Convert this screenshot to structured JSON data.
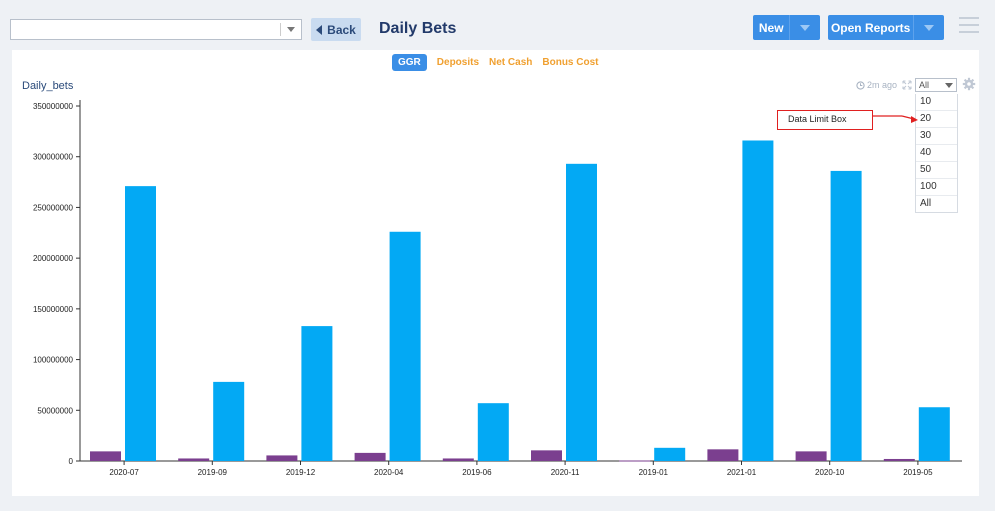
{
  "header": {
    "dashboard_select_value": "",
    "back_label": "Back",
    "title": "Daily Bets",
    "new_label": "New",
    "open_reports_label": "Open Reports"
  },
  "tabs": [
    {
      "label": "GGR",
      "active": true
    },
    {
      "label": "Deposits",
      "active": false
    },
    {
      "label": "Net Cash",
      "active": false
    },
    {
      "label": "Bonus Cost",
      "active": false
    }
  ],
  "widget": {
    "title": "Daily_bets",
    "updated": "2m ago",
    "limit_value": "All",
    "limit_options": [
      "10",
      "20",
      "30",
      "40",
      "50",
      "100",
      "All"
    ],
    "annotation": "Data Limit Box"
  },
  "colors": {
    "accent": "#3a8ee6",
    "tab_inactive": "#f0a030",
    "series_small": "#7b3f8f",
    "series_large": "#03a9f4",
    "annotation": "#e02020"
  },
  "chart_data": {
    "type": "bar",
    "title": "Daily_bets",
    "categories": [
      "2020-07",
      "2019-09",
      "2019-12",
      "2020-04",
      "2019-06",
      "2020-11",
      "2019-01",
      "2021-01",
      "2020-10",
      "2019-05"
    ],
    "series": [
      {
        "values": [
          9500000,
          2500000,
          5500000,
          8000000,
          2500000,
          10500000,
          500000,
          11500000,
          9500000,
          2000000
        ]
      },
      {
        "values": [
          271000000,
          78000000,
          133000000,
          226000000,
          57000000,
          293000000,
          13000000,
          316000000,
          286000000,
          53000000
        ]
      }
    ],
    "yticks": [
      "0",
      "50000000",
      "100000000",
      "150000000",
      "200000000",
      "250000000",
      "300000000",
      "350000000"
    ],
    "ylim": [
      0,
      350000000
    ],
    "grid": false,
    "legend": "none"
  }
}
